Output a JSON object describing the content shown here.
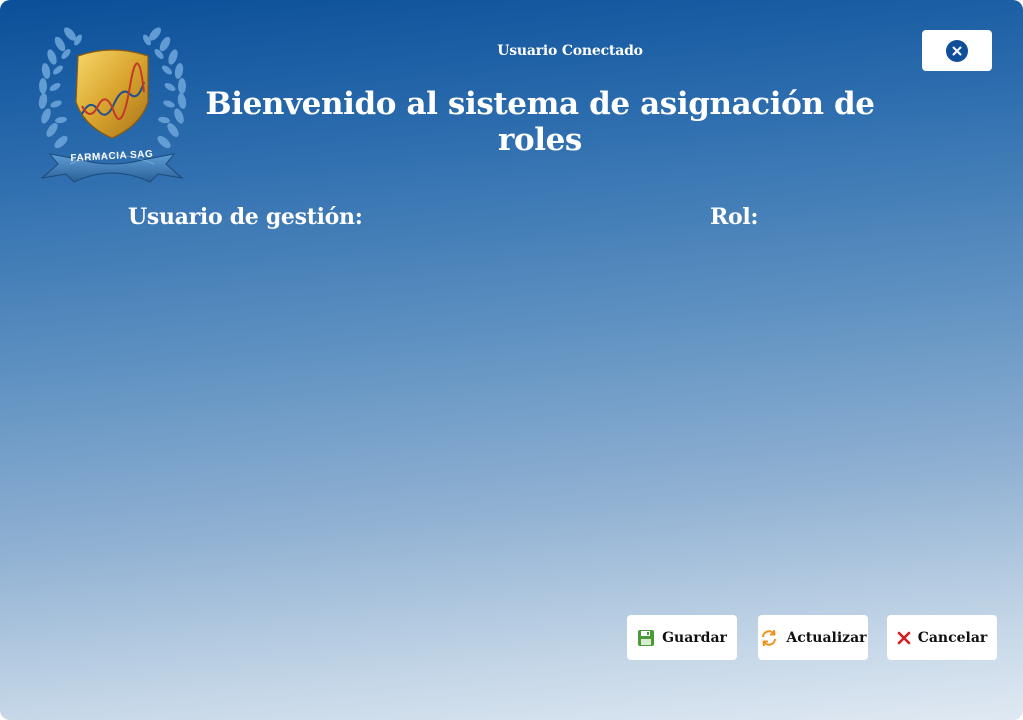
{
  "logo": {
    "brand_text": "FARMACIA SAG",
    "icon": "laurel-shield-dna-logo"
  },
  "header": {
    "connected_user": "Usuario Conectado",
    "title": "Bienvenido al sistema de asignación de roles",
    "close_icon": "close-icon"
  },
  "form": {
    "user_label": "Usuario de gestión:",
    "role_label": "Rol:"
  },
  "actions": {
    "save_label": "Guardar",
    "save_icon": "floppy-disk-icon",
    "refresh_label": "Actualizar",
    "refresh_icon": "refresh-icon",
    "cancel_label": "Cancelar",
    "cancel_icon": "x-icon"
  },
  "colors": {
    "gradient_top": "#0a4f99",
    "gradient_bottom": "#e0e9f3",
    "close_circle": "#0f4f99",
    "save_icon": "#4a9a3a",
    "refresh_icon": "#f0901c",
    "cancel_icon": "#d21e1e"
  }
}
